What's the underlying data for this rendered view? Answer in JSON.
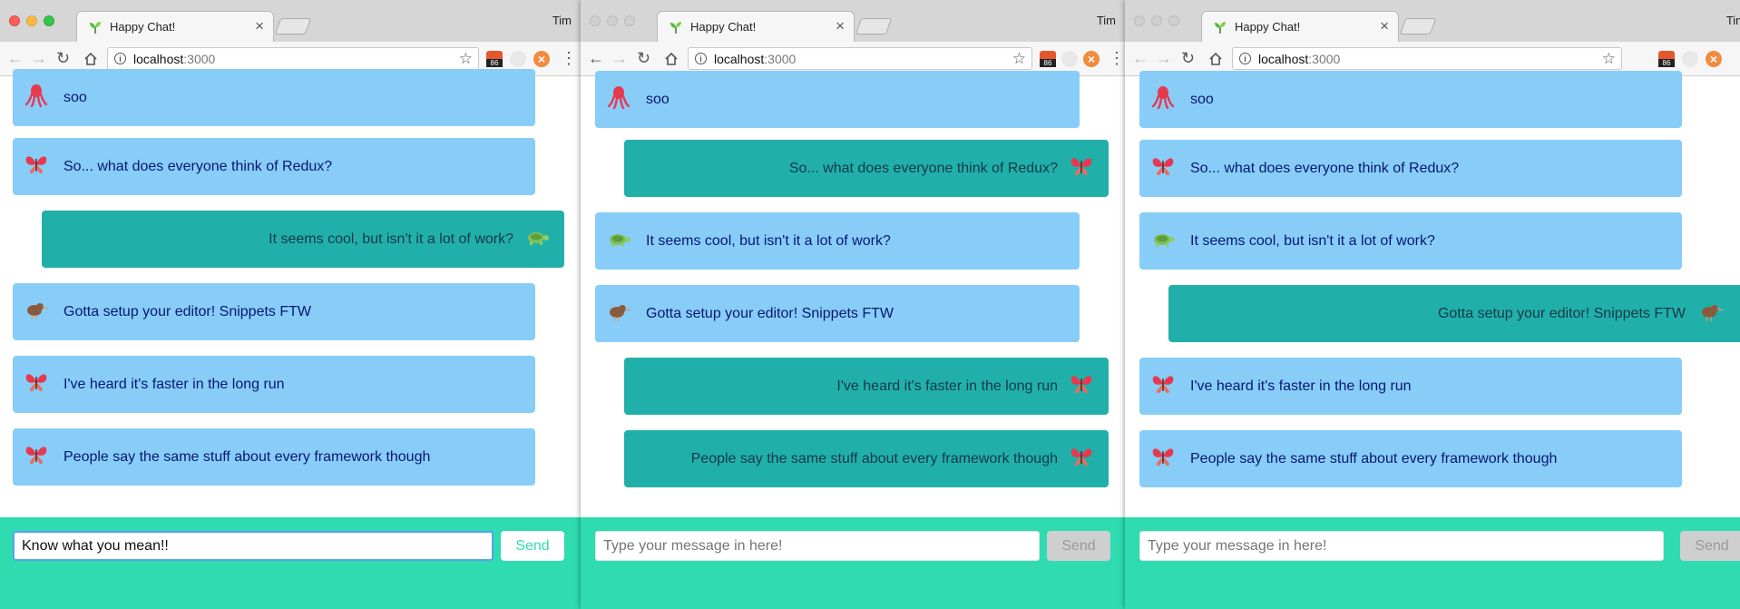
{
  "browser": {
    "tab_title": "Happy Chat!",
    "profile": "Tim",
    "url_host": "localhost",
    "url_port": ":3000",
    "extension_badge": "86"
  },
  "windows": [
    {
      "messages": [
        {
          "text": "soo",
          "avatar": "octopus-icon",
          "side": "received"
        },
        {
          "text": "So... what does everyone think of Redux?",
          "avatar": "butterfly-icon",
          "side": "received"
        },
        {
          "text": "It seems cool, but isn't it a lot of work?",
          "avatar": "turtle-icon",
          "side": "sent"
        },
        {
          "text": "Gotta setup your editor! Snippets FTW",
          "avatar": "kiwi-bird-icon",
          "side": "received"
        },
        {
          "text": "I've heard it's faster in the long run",
          "avatar": "butterfly-icon",
          "side": "received"
        },
        {
          "text": "People say the same stuff about every framework though",
          "avatar": "butterfly-icon",
          "side": "received"
        }
      ],
      "input_value": "Know what you mean!!",
      "input_placeholder": "Type your message in here!",
      "send_label": "Send",
      "send_enabled": true
    },
    {
      "messages": [
        {
          "text": "soo",
          "avatar": "octopus-icon",
          "side": "received"
        },
        {
          "text": "So... what does everyone think of Redux?",
          "avatar": "butterfly-icon",
          "side": "sent"
        },
        {
          "text": "It seems cool, but isn't it a lot of work?",
          "avatar": "turtle-icon",
          "side": "received"
        },
        {
          "text": "Gotta setup your editor! Snippets FTW",
          "avatar": "kiwi-bird-icon",
          "side": "received"
        },
        {
          "text": "I've heard it's faster in the long run",
          "avatar": "butterfly-icon",
          "side": "sent"
        },
        {
          "text": "People say the same stuff about every framework though",
          "avatar": "butterfly-icon",
          "side": "sent"
        }
      ],
      "input_value": "",
      "input_placeholder": "Type your message in here!",
      "send_label": "Send",
      "send_enabled": false
    },
    {
      "messages": [
        {
          "text": "soo",
          "avatar": "octopus-icon",
          "side": "received"
        },
        {
          "text": "So... what does everyone think of Redux?",
          "avatar": "butterfly-icon",
          "side": "received"
        },
        {
          "text": "It seems cool, but isn't it a lot of work?",
          "avatar": "turtle-icon",
          "side": "received"
        },
        {
          "text": "Gotta setup your editor! Snippets FTW",
          "avatar": "kiwi-bird-icon",
          "side": "sent"
        },
        {
          "text": "I've heard it's faster in the long run",
          "avatar": "butterfly-icon",
          "side": "received"
        },
        {
          "text": "People say the same stuff about every framework though",
          "avatar": "butterfly-icon",
          "side": "received"
        }
      ],
      "input_value": "",
      "input_placeholder": "Type your message in here!",
      "send_label": "Send",
      "send_enabled": false
    }
  ],
  "colors": {
    "received_bubble": "#87cdf8",
    "sent_bubble": "#21b0a9",
    "composer_bar": "#2edcb0",
    "message_text": "#0a1670"
  }
}
